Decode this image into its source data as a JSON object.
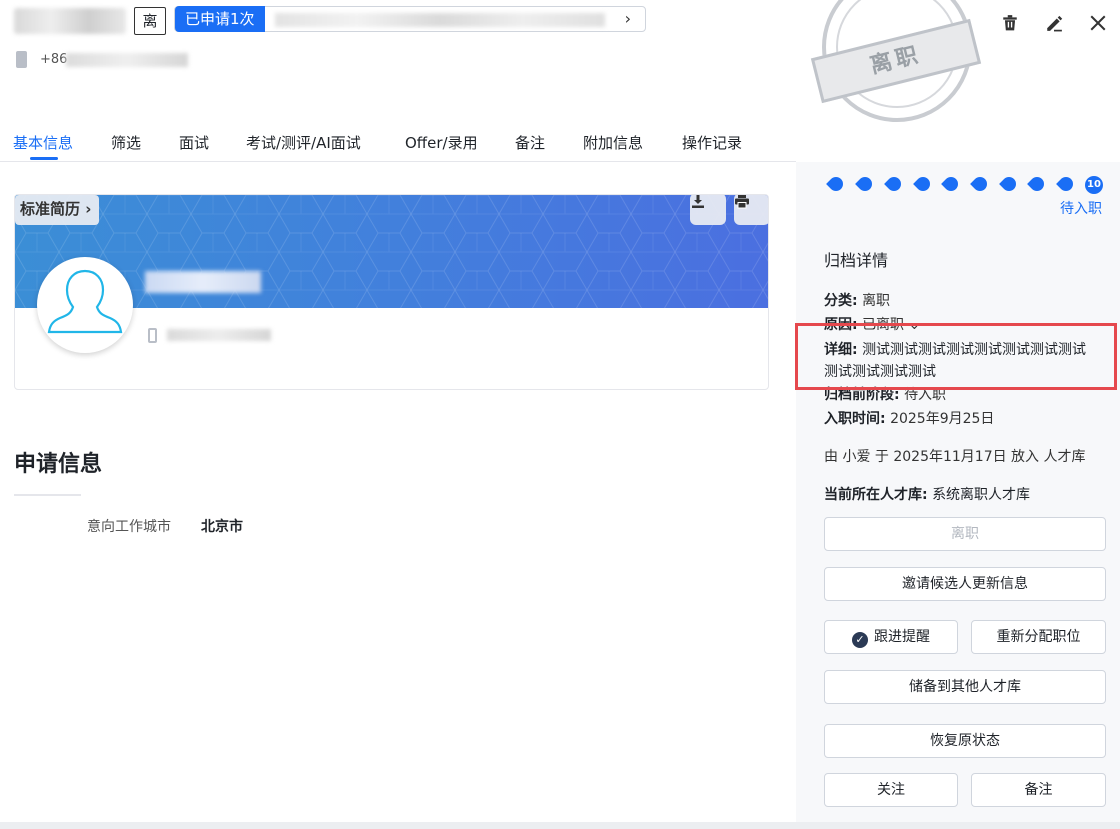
{
  "header": {
    "status_tag": "离",
    "applied_badge": "已申请1次",
    "applied_chevron": "›",
    "phone_prefix": "+86",
    "stamp_text": "离职",
    "actions": [
      "trash-icon",
      "edit-icon",
      "close-icon"
    ]
  },
  "tabs": [
    "基本信息",
    "筛选",
    "面试",
    "考试/测评/AI面试",
    "Offer/录用",
    "备注",
    "附加信息",
    "操作记录"
  ],
  "active_tab": "基本信息",
  "resume": {
    "standard_resume_label": "标准简历",
    "download_icon": "download-icon",
    "print_icon": "print-icon"
  },
  "application": {
    "section_title": "申请信息",
    "city_label": "意向工作城市",
    "city_value": "北京市"
  },
  "right_panel": {
    "stage_count": "10",
    "stage_label": "待入职",
    "archive_title": "归档详情",
    "category_label": "分类:",
    "category_value": "离职",
    "reason_label": "原因:",
    "reason_value": "已离职",
    "detail_label": "详细:",
    "detail_value": "测试测试测试测试测试测试测试测试测试测试测试测试",
    "pre_stage_label": "归档前阶段:",
    "pre_stage_value": "待入职",
    "onboard_label": "入职时间:",
    "onboard_value": "2025年9月25日",
    "archive_note": "由 小爱 于 2025年11月17日 放入 人才库",
    "pool_label": "当前所在人才库:",
    "pool_value": "系统离职人才库",
    "buttons": {
      "resign": "离职",
      "invite_update": "邀请候选人更新信息",
      "follow_reminder": "跟进提醒",
      "reassign": "重新分配职位",
      "save_to_pool": "储备到其他人才库",
      "restore": "恢复原状态",
      "follow": "关注",
      "note": "备注"
    }
  },
  "colors": {
    "accent": "#1a6ef5",
    "highlight_border": "#e5484d",
    "panel_bg": "#f7f8fa"
  }
}
